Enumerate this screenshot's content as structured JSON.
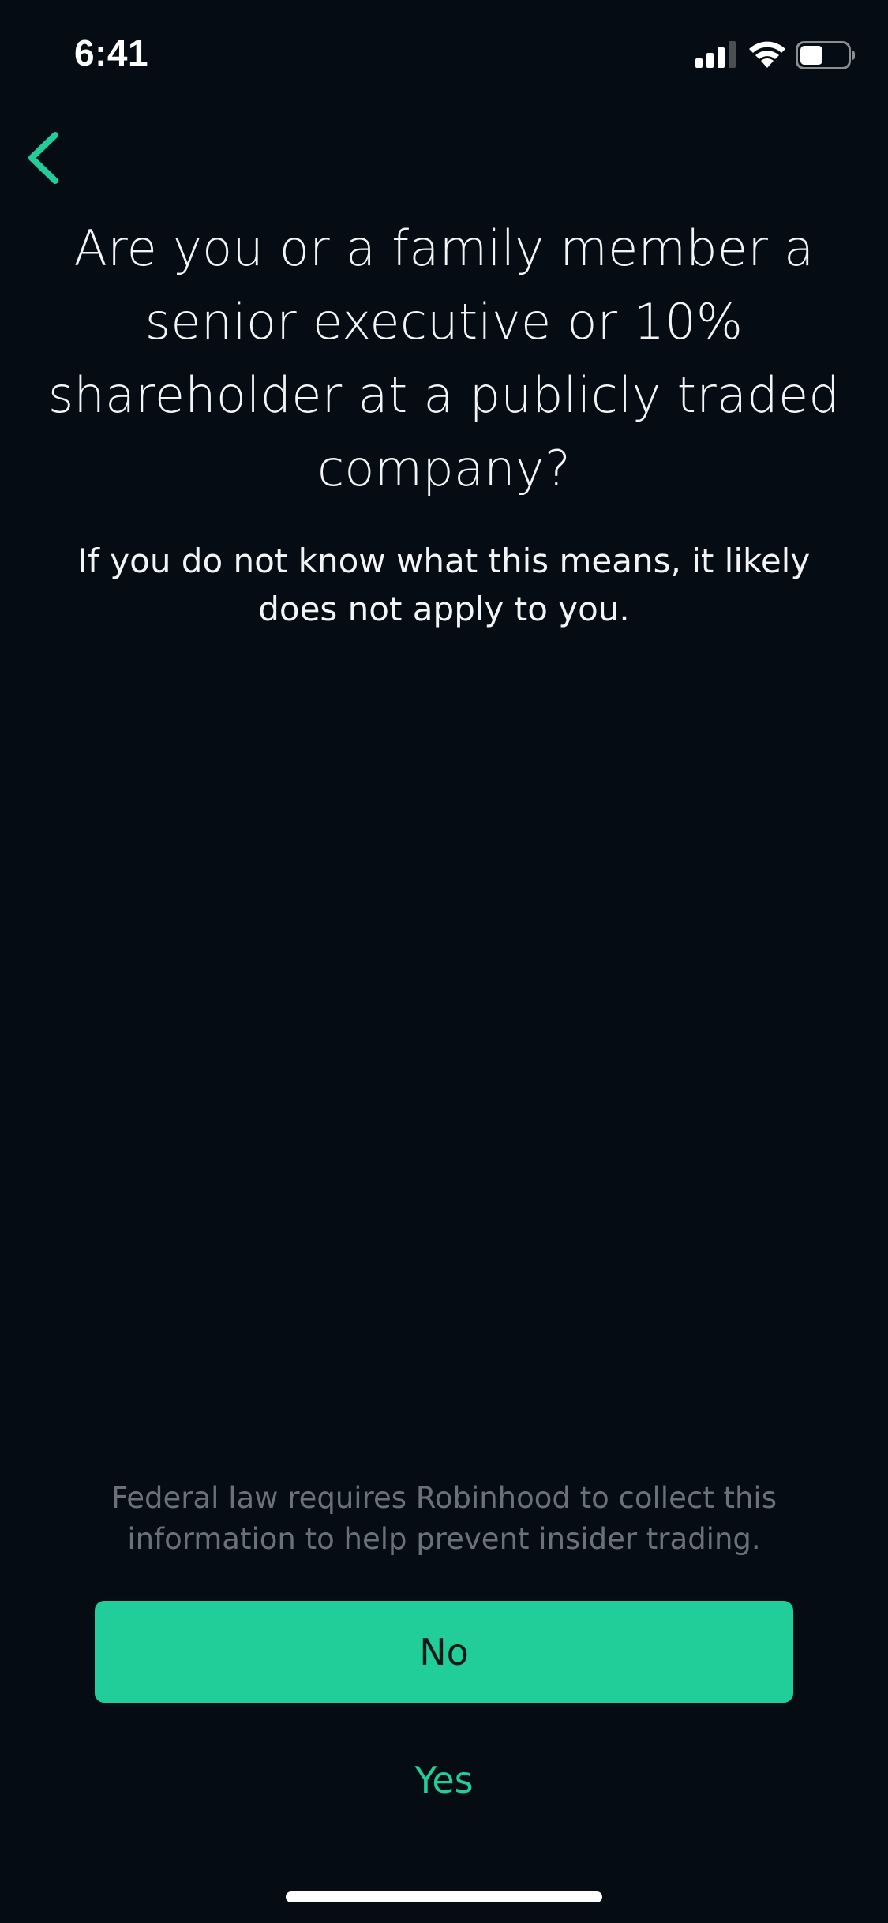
{
  "status_bar": {
    "time": "6:41",
    "icons": [
      "signal-icon",
      "wifi-icon",
      "battery-icon"
    ]
  },
  "nav": {
    "back_icon": "chevron-left-icon"
  },
  "question": {
    "title": "Are you or a family member a senior executive or 10% shareholder at a publicly traded company?",
    "subtitle": "If you do not know what this means, it likely does not apply to you."
  },
  "footer": {
    "disclaimer": "Federal law requires Robinhood to collect this information to help prevent insider trading.",
    "no_label": "No",
    "yes_label": "Yes"
  },
  "colors": {
    "background": "#060c14",
    "accent": "#21ce99",
    "muted_text": "#6b7178"
  }
}
